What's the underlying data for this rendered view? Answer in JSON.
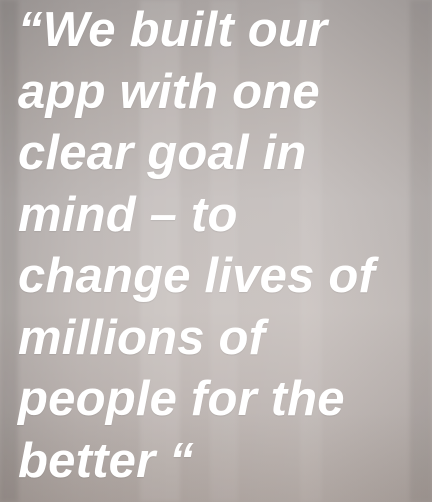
{
  "quote": {
    "lines": [
      "“We built our",
      "app with one",
      "clear goal in",
      "mind – to",
      "change lives of",
      "millions of",
      "people for the",
      "better “"
    ]
  }
}
